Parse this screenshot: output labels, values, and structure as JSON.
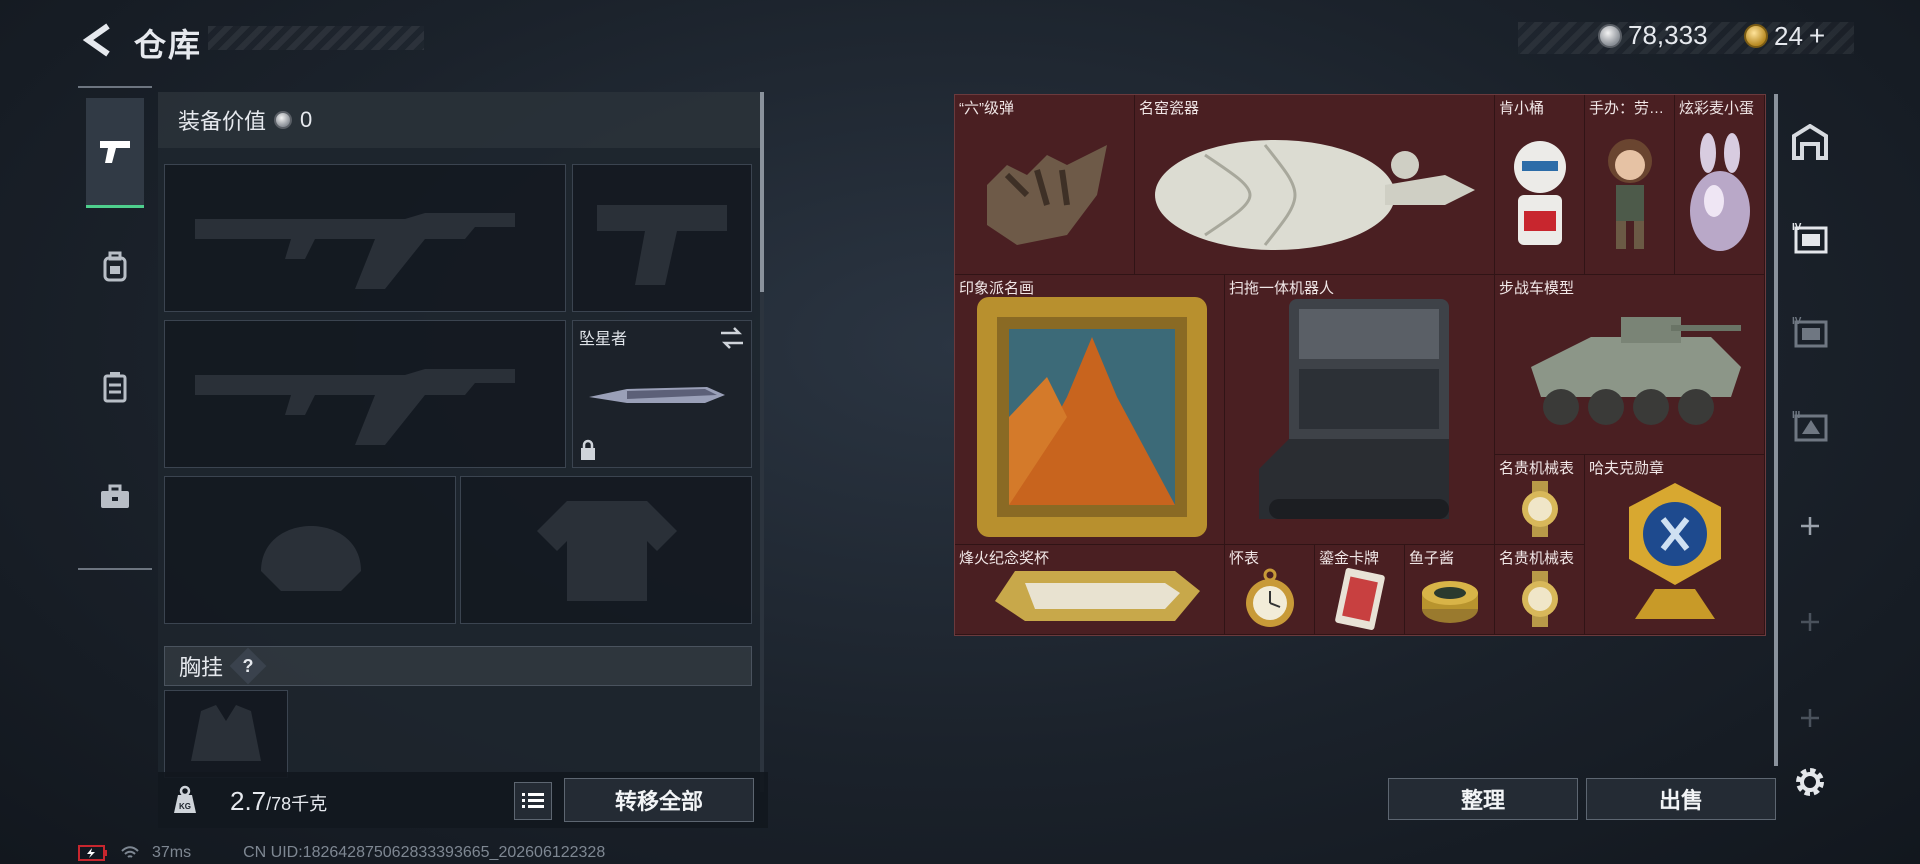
{
  "header": {
    "title": "仓库",
    "silver_amount": "78,333",
    "gold_amount": "24",
    "gold_add": "+"
  },
  "tabs": [
    {
      "name": "weapons",
      "icon": "pistol-icon",
      "active": true
    },
    {
      "name": "armor",
      "icon": "backpack-icon",
      "active": false
    },
    {
      "name": "rig",
      "icon": "vest-icon",
      "active": false
    },
    {
      "name": "case",
      "icon": "toolbox-icon",
      "active": false
    }
  ],
  "equipment": {
    "value_label": "装备价值",
    "value_amount": "0",
    "melee_label": "坠星者",
    "chest_label": "胸挂",
    "chest_help": "?",
    "weight_current": "2.7",
    "weight_max": "/78千克",
    "transfer_all": "转移全部"
  },
  "stash_items": [
    {
      "label": "“六”级弹",
      "icon": "hand-sculpture-icon"
    },
    {
      "label": "名窑瓷器",
      "icon": "porcelain-vase-icon"
    },
    {
      "label": "肯小桶",
      "icon": "kfc-figure-icon"
    },
    {
      "label": "手办：劳…",
      "icon": "figurine-icon"
    },
    {
      "label": "炫彩麦小蛋",
      "icon": "bunny-egg-icon"
    },
    {
      "label": "印象派名画",
      "icon": "painting-icon"
    },
    {
      "label": "扫拖一体机器人",
      "icon": "robot-vacuum-icon"
    },
    {
      "label": "步战车模型",
      "icon": "ifv-model-icon"
    },
    {
      "label": "名贵机械表",
      "icon": "watch-icon"
    },
    {
      "label": "哈夫克勋章",
      "icon": "medal-icon"
    },
    {
      "label": "烽火纪念奖杯",
      "icon": "trophy-icon"
    },
    {
      "label": "怀表",
      "icon": "pocket-watch-icon"
    },
    {
      "label": "鎏金卡牌",
      "icon": "gold-card-icon"
    },
    {
      "label": "鱼子酱",
      "icon": "caviar-icon"
    },
    {
      "label": "名贵机械表",
      "icon": "watch-icon"
    }
  ],
  "actions": {
    "sort": "整理",
    "sell": "出售"
  },
  "status": {
    "ping": "37ms",
    "uid": "CN UID:1826428750628333936​65_202606122328"
  },
  "colors": {
    "accent_green": "#4ecf8d",
    "stash_bg": "#4a1f22"
  }
}
